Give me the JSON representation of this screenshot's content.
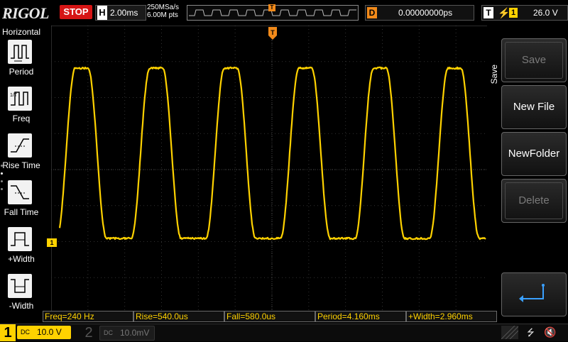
{
  "topbar": {
    "logo": "RIGOL",
    "run_state": "STOP",
    "horizontal_letter": "H",
    "timebase": "2.00ms",
    "sample_rate": "250MSa/s",
    "memory_depth": "6.00M pts",
    "trigger_marker": "T",
    "delay_letter": "D",
    "delay_value": "0.00000000ps",
    "trigger_letter": "T",
    "trigger_channel": "1",
    "trigger_level": "26.0 V"
  },
  "left_menu": {
    "title": "Horizontal",
    "items": [
      {
        "label": "Period",
        "icon": "period-icon"
      },
      {
        "label": "Freq",
        "icon": "freq-icon"
      },
      {
        "label": "Rise Time",
        "icon": "rise-time-icon"
      },
      {
        "label": "Fall Time",
        "icon": "fall-time-icon"
      },
      {
        "label": "+Width",
        "icon": "pos-width-icon"
      },
      {
        "label": "-Width",
        "icon": "neg-width-icon"
      }
    ]
  },
  "right_menu": {
    "title": "Save",
    "buttons": [
      {
        "label": "Save",
        "enabled": false
      },
      {
        "label": "New File",
        "enabled": true
      },
      {
        "label": "NewFolder",
        "enabled": true
      },
      {
        "label": "Delete",
        "enabled": false
      },
      {
        "label": "",
        "icon": "enter-return-icon",
        "enabled": true
      }
    ]
  },
  "markers": {
    "ch1_ground": "1",
    "trigger_position": "T"
  },
  "measurements": [
    "Freq=240 Hz",
    "Rise=540.0us",
    "Fall=580.0us",
    "Period=4.160ms",
    "+Width=2.960ms"
  ],
  "channels": {
    "ch1": {
      "number": "1",
      "coupling": "DC",
      "scale": "10.0 V",
      "color": "#ffd200"
    },
    "ch2": {
      "number": "2",
      "coupling": "DC",
      "scale": "10.0mV",
      "color": "#555555"
    }
  },
  "colors": {
    "trace": "#ffd200",
    "trigger": "#f28a1a",
    "stop": "#d61515",
    "accent_blue": "#3aa0ff"
  }
}
